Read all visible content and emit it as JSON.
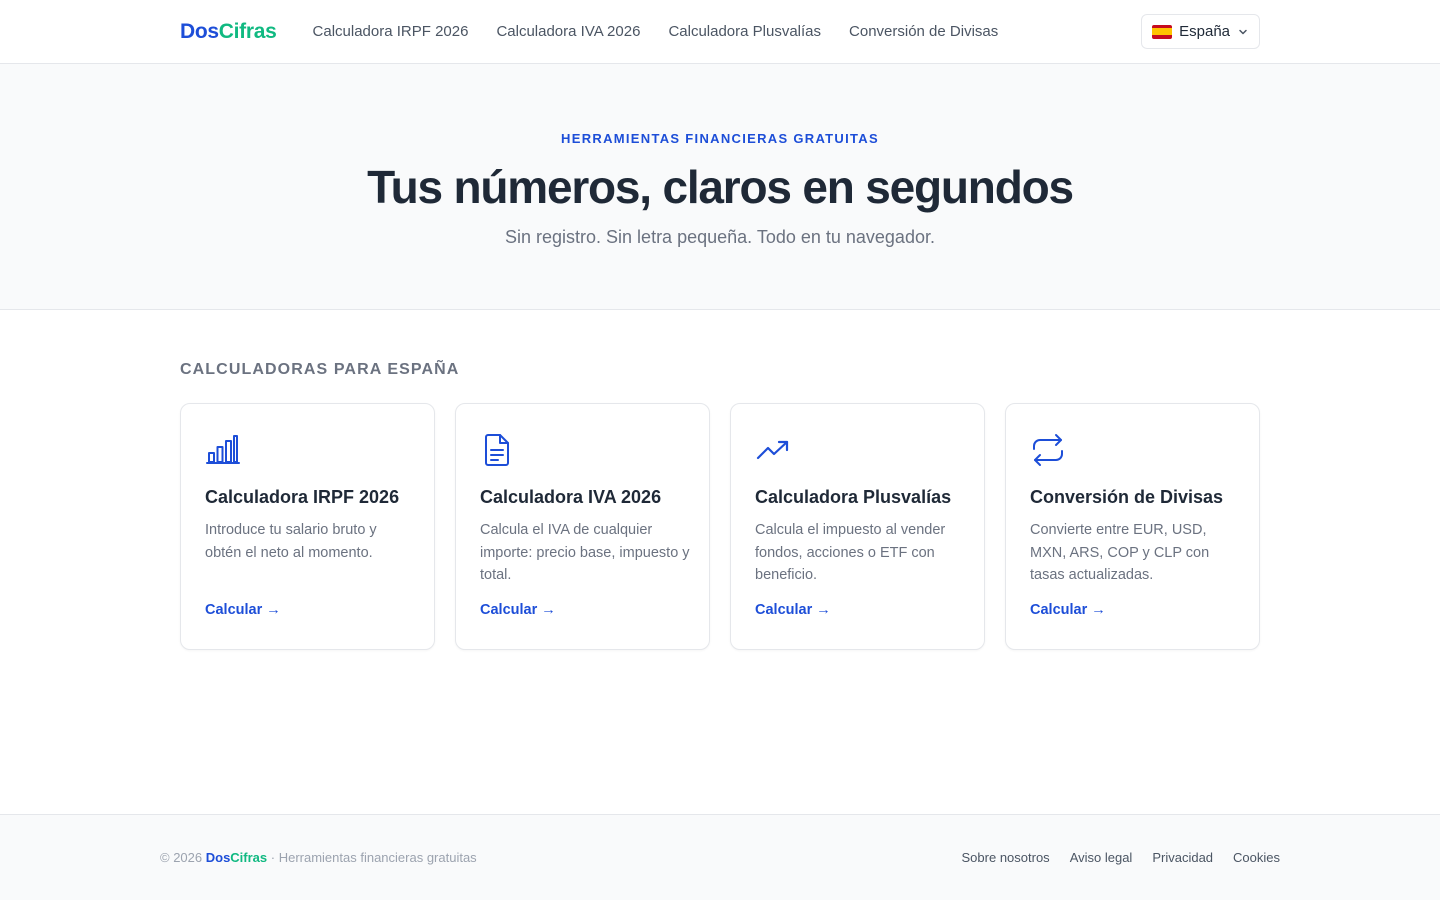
{
  "header": {
    "logo_part1": "Dos",
    "logo_part2": "Cifras",
    "nav": [
      "Calculadora IRPF 2026",
      "Calculadora IVA 2026",
      "Calculadora Plusvalías",
      "Conversión de Divisas"
    ],
    "country": "España",
    "country_flag_icon": "spain-flag-icon"
  },
  "hero": {
    "eyebrow": "HERRAMIENTAS FINANCIERAS GRATUITAS",
    "title": "Tus números, claros en segundos",
    "subtitle": "Sin registro. Sin letra pequeña. Todo en tu navegador."
  },
  "section": {
    "title": "CALCULADORAS PARA ESPAÑA"
  },
  "cards": [
    {
      "icon": "bar-chart-icon",
      "title": "Calculadora IRPF 2026",
      "description": "Introduce tu salario bruto y obtén el neto al momento.",
      "cta": "Calcular →"
    },
    {
      "icon": "document-icon",
      "title": "Calculadora IVA 2026",
      "description": "Calcula el IVA de cualquier importe: precio base, impuesto y total.",
      "cta": "Calcular →"
    },
    {
      "icon": "trending-up-icon",
      "title": "Calculadora Plusvalías",
      "description": "Calcula el impuesto al vender fondos, acciones o ETF con beneficio.",
      "cta": "Calcular →"
    },
    {
      "icon": "exchange-arrows-icon",
      "title": "Conversión de Divisas",
      "description": "Convierte entre EUR, USD, MXN, ARS, COP y CLP con tasas actualizadas.",
      "cta": "Calcular →"
    }
  ],
  "footer": {
    "copyright": "© 2026 ",
    "brand_part1": "Dos",
    "brand_part2": "Cifras",
    "tagline": " · Herramientas financieras gratuitas",
    "links": [
      "Sobre nosotros",
      "Aviso legal",
      "Privacidad",
      "Cookies"
    ]
  },
  "colors": {
    "primary": "#1d4ed8",
    "accent_green": "#10b981",
    "text": "#1f2937",
    "muted": "#6b7280",
    "border": "#e5e7eb",
    "hero_bg": "#f9fafb"
  }
}
